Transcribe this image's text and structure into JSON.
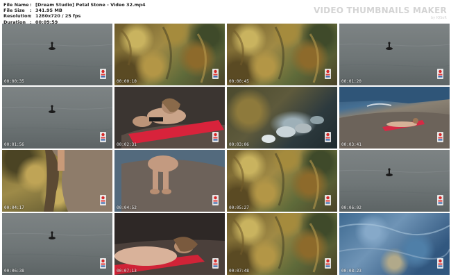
{
  "header": {
    "rows": [
      {
        "label": "File Name",
        "value": "[Dream Studio] Petal Stone - Video 32.mp4"
      },
      {
        "label": "File Size",
        "value": "341.95 MB"
      },
      {
        "label": "Resolution",
        "value": "1280x720 / 25 fps"
      },
      {
        "label": "Duration",
        "value": "00:09:59"
      }
    ],
    "brand_title": "VIDEO THUMBNAILS MAKER",
    "brand_sub": "by IQSoft"
  },
  "thumbnails": [
    {
      "time": "00:00:35",
      "scene": "water-bird"
    },
    {
      "time": "00:00:10",
      "scene": "seaweed"
    },
    {
      "time": "00:00:45",
      "scene": "seaweed"
    },
    {
      "time": "00:01:20",
      "scene": "water-bird"
    },
    {
      "time": "00:01:56",
      "scene": "water-bird"
    },
    {
      "time": "00:02:31",
      "scene": "woman-towel"
    },
    {
      "time": "00:03:06",
      "scene": "fish"
    },
    {
      "time": "00:03:41",
      "scene": "shore-woman"
    },
    {
      "time": "00:04:17",
      "scene": "rock-water"
    },
    {
      "time": "00:04:52",
      "scene": "woman-sitting"
    },
    {
      "time": "00:05:27",
      "scene": "seaweed"
    },
    {
      "time": "00:06:02",
      "scene": "water-bird"
    },
    {
      "time": "00:06:38",
      "scene": "water-bird"
    },
    {
      "time": "00:07:13",
      "scene": "woman-lying"
    },
    {
      "time": "00:07:48",
      "scene": "seaweed"
    },
    {
      "time": "00:08:23",
      "scene": "blue-water"
    }
  ]
}
